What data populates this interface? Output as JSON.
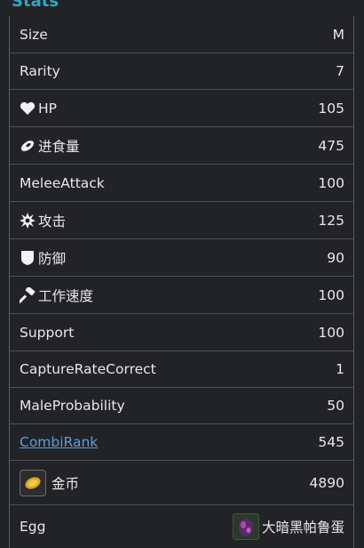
{
  "title": "Stats",
  "rows": [
    {
      "label": "Size",
      "value": "M"
    },
    {
      "label": "Rarity",
      "value": "7"
    },
    {
      "label": "HP",
      "value": "105",
      "icon": "heart-icon"
    },
    {
      "label": "进食量",
      "value": "475",
      "icon": "food-icon"
    },
    {
      "label": "MeleeAttack",
      "value": "100"
    },
    {
      "label": "攻击",
      "value": "125",
      "icon": "burst-icon"
    },
    {
      "label": "防御",
      "value": "90",
      "icon": "shield-icon"
    },
    {
      "label": "工作速度",
      "value": "100",
      "icon": "hammer-icon"
    },
    {
      "label": "Support",
      "value": "100"
    },
    {
      "label": "CaptureRateCorrect",
      "value": "1"
    },
    {
      "label": "MaleProbability",
      "value": "50"
    },
    {
      "label": "CombiRank",
      "value": "545",
      "link": true
    },
    {
      "label": "金币",
      "value": "4890",
      "icon": "gold-coin-icon"
    },
    {
      "label": "Egg",
      "value": "大暗黑帕鲁蛋",
      "icon": "dark-egg-icon"
    }
  ],
  "colors": {
    "accent": "#2fa8c8",
    "link": "#5b9ee0",
    "background": "#222327"
  }
}
